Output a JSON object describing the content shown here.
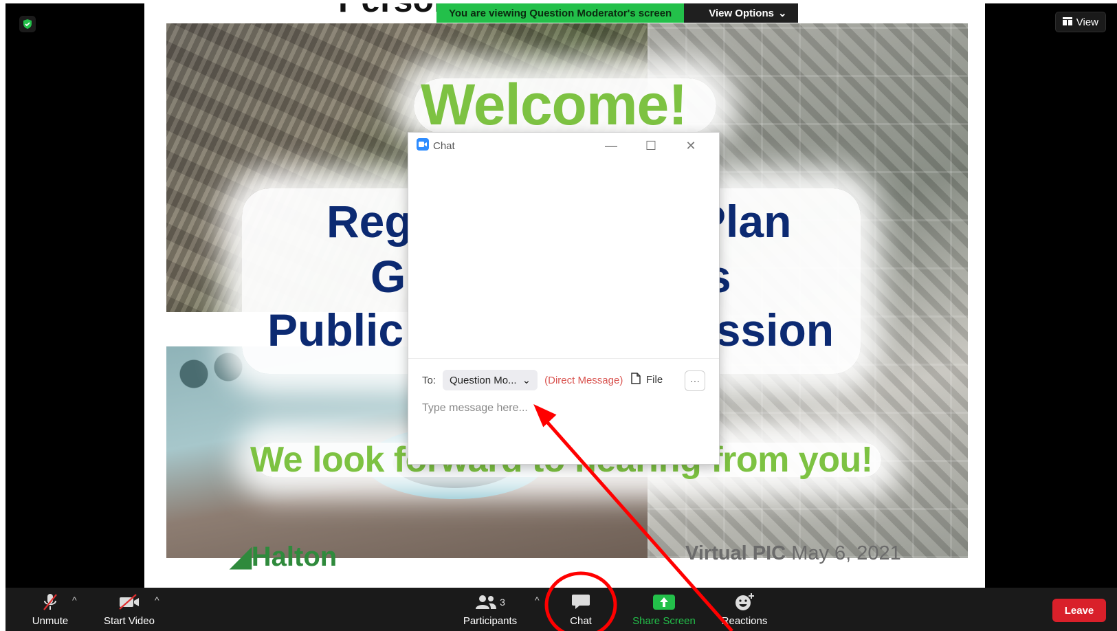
{
  "app": {
    "document_title_partial": "Personal Computer",
    "view_label": "View"
  },
  "banner": {
    "viewing_text": "You are viewing Question Moderator's screen",
    "view_options_label": "View Options"
  },
  "slide": {
    "welcome": "Welcome!",
    "line1_left": "Reg",
    "line1_right": "Plan",
    "line2_left": "G",
    "line2_right": "ts",
    "line3_left": "Public",
    "line3_right": "ession",
    "footer_message": "We look forward to hearing from you!",
    "logo_text": "Halton",
    "event_name": "Virtual PIC",
    "event_date": "May 6, 2021"
  },
  "chat": {
    "title": "Chat",
    "to_label": "To:",
    "recipient": "Question Mo...",
    "direct_message_label": "(Direct Message)",
    "file_label": "File",
    "more_label": "···",
    "message_placeholder": "Type message here..."
  },
  "toolbar": {
    "unmute_label": "Unmute",
    "start_video_label": "Start Video",
    "participants_label": "Participants",
    "participants_count": "3",
    "chat_label": "Chat",
    "share_screen_label": "Share Screen",
    "reactions_label": "Reactions",
    "leave_label": "Leave"
  },
  "colors": {
    "banner_green": "#23c04a",
    "leave_red": "#d9202a",
    "slide_title_blue": "#0c2a72",
    "slide_green": "#7dc242",
    "annotation_red": "#ff0000"
  },
  "icons": {
    "shield": "shield-check-icon",
    "view": "grid-view-icon",
    "chat_app": "zoom-chat-icon",
    "file": "file-icon",
    "unmute": "muted-microphone-icon",
    "video": "video-off-icon",
    "participants": "participants-icon",
    "chat": "chat-bubble-icon",
    "share": "share-screen-icon",
    "reactions": "smiley-icon"
  }
}
